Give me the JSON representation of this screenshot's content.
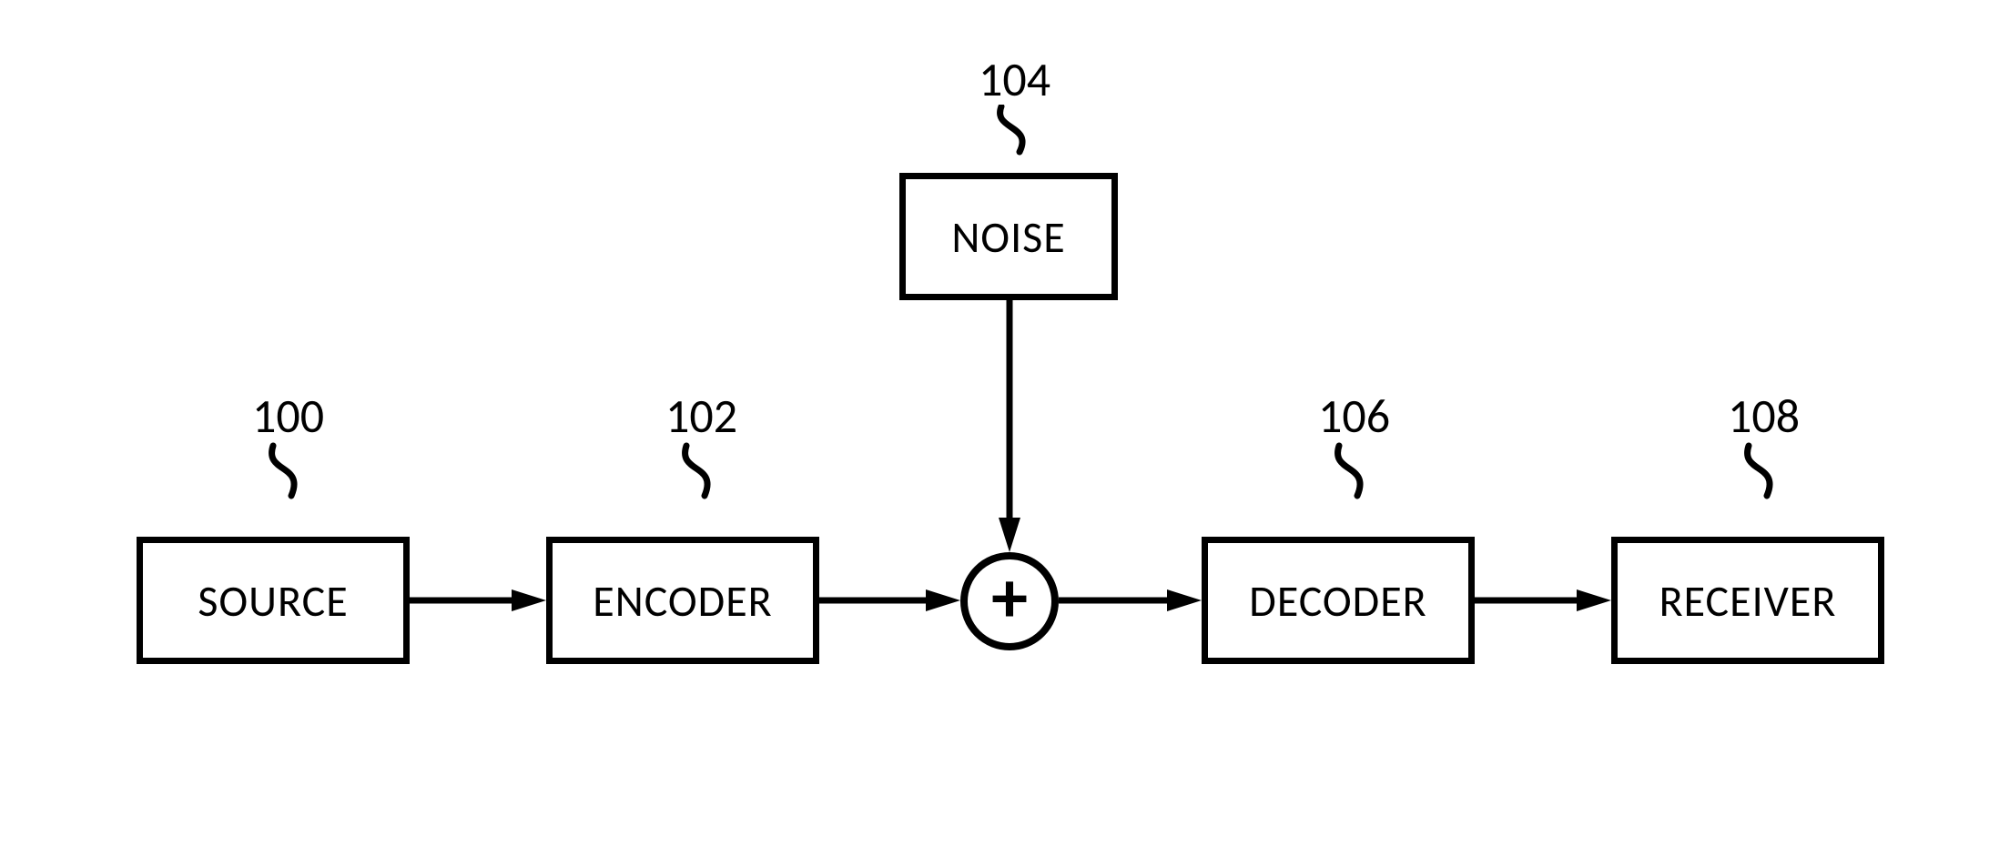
{
  "diagram": {
    "blocks": {
      "source": {
        "label": "SOURCE",
        "ref": "100"
      },
      "encoder": {
        "label": "ENCODER",
        "ref": "102"
      },
      "noise": {
        "label": "NOISE",
        "ref": "104"
      },
      "decoder": {
        "label": "DECODER",
        "ref": "106"
      },
      "receiver": {
        "label": "RECEIVER",
        "ref": "108"
      }
    },
    "adder": {
      "symbol": "+"
    }
  }
}
